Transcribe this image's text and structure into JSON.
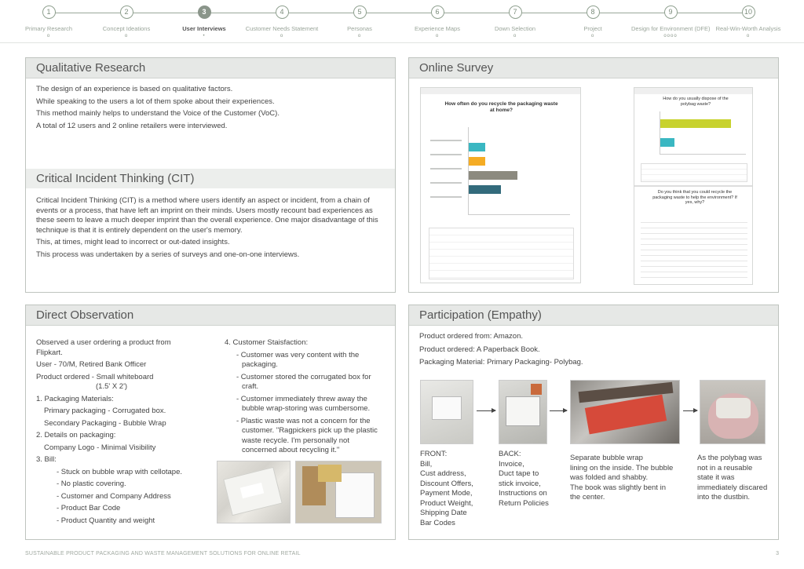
{
  "steps": [
    {
      "num": "1",
      "label": "Primary Research",
      "dots": "o"
    },
    {
      "num": "2",
      "label": "Concept Ideations",
      "dots": "o"
    },
    {
      "num": "3",
      "label": "User Interviews",
      "dots": "•"
    },
    {
      "num": "4",
      "label": "Customer Needs Statement",
      "dots": "o"
    },
    {
      "num": "5",
      "label": "Personas",
      "dots": "o"
    },
    {
      "num": "6",
      "label": "Experience Maps",
      "dots": "o"
    },
    {
      "num": "7",
      "label": "Down Selection",
      "dots": "o"
    },
    {
      "num": "8",
      "label": "Project",
      "dots": "o"
    },
    {
      "num": "9",
      "label": "Design for Environment (DFE)",
      "dots": "oooo"
    },
    {
      "num": "10",
      "label": "Real-Win-Worth Analysis",
      "dots": "o"
    }
  ],
  "qualitative": {
    "title": "Qualitative Research",
    "lines": [
      "The design of an experience is based on qualitative factors.",
      "While speaking to the users a lot of them spoke about their experiences.",
      "This method mainly helps to understand the Voice of the Customer (VoC).",
      "A total of 12 users and 2 online retailers were interviewed."
    ]
  },
  "cit": {
    "title": "Critical Incident Thinking (CIT)",
    "lines": [
      "Critical Incident Thinking (CIT) is a method where users identify an aspect or incident, from a chain of events or a process, that have left an imprint on their minds. Users mostly recount bad experiences as these seem to leave a much deeper imprint than the overall experience. One major disadvantage of this technique is that it is entirely dependent on the user's memory.",
      "This, at times, might lead to incorrect or out-dated insights.",
      "This process was undertaken by a series of surveys and one-on-one interviews."
    ]
  },
  "survey": {
    "title": "Online Survey",
    "question1": "How often do you recycle the packaging waste at home?",
    "question2": "How do you usually dispose of the polybag waste?",
    "question3": "Do you think that you could recycle the packaging waste to help the environment? If yes, why?",
    "chart1_values": [
      0.0,
      0.14,
      0.14,
      0.41,
      0.27,
      0.0
    ],
    "chart1_colors": [
      "#3ab7c2",
      "#f5ac24",
      "#8c8a7f",
      "#336b7c"
    ],
    "chart2_values": [
      0.82,
      0.18
    ],
    "chart2_colors": [
      "#c8d22e",
      "#3ab7c2"
    ]
  },
  "direct": {
    "title": "Direct Observation",
    "intro": "Observed a user ordering a product from Flipkart.",
    "user": "User - 70/M, Retired Bank Officer",
    "product": "Product ordered - Small whiteboard",
    "size": "(1.5' X 2')",
    "packaging_head": "1. Packaging Materials:",
    "primary": "Primary packaging - Corrugated box.",
    "secondary": "Secondary Packaging - Bubble Wrap",
    "details_head": "2. Details on packaging:",
    "logo": "Company Logo - Minimal Visibility",
    "bill_head": "3. Bill:",
    "bill_items": [
      "- Stuck on bubble wrap with cellotape.",
      "- No plastic covering.",
      "- Customer and Company Address",
      "- Product Bar Code",
      "- Product Quantity and weight"
    ],
    "satisfaction_head": "4. Customer Staisfaction:",
    "satisfaction_items": [
      "- Customer was very content with the packaging.",
      "- Customer stored the corrugated box for craft.",
      "- Customer immediately threw away the bubble wrap-storing was cumbersome.",
      "- Plastic waste was not a concern for the customer. \"Ragpickers pick up the plastic waste recycle. I'm personally not concerned about recycling it.\""
    ]
  },
  "participation": {
    "title": "Participation (Empathy)",
    "lines": [
      "Product ordered from: Amazon.",
      "Product ordered: A Paperback Book.",
      "Packaging Material: Primary Packaging- Polybag."
    ],
    "front": [
      "FRONT:",
      "Bill,",
      "Cust address,",
      "Discount Offers,",
      "Payment Mode,",
      "Product Weight,",
      "Shipping Date",
      "Bar Codes"
    ],
    "back": [
      "BACK:",
      "Invoice,",
      "Duct tape to",
      "stick invoice,",
      "Instructions on",
      "Return Policies"
    ],
    "third": [
      "Separate bubble wrap",
      "lining on the inside. The bubble",
      "was folded and shabby.",
      "The book was slightly bent in",
      "the center."
    ],
    "fourth": [
      "As the polybag was",
      "not in a reusable",
      "state it was",
      "immediately discared",
      "into the dustbin."
    ]
  },
  "footer": {
    "text": "SUSTAINABLE PRODUCT PACKAGING AND WASTE MANAGEMENT SOLUTIONS FOR ONLINE RETAIL",
    "page": "3"
  }
}
